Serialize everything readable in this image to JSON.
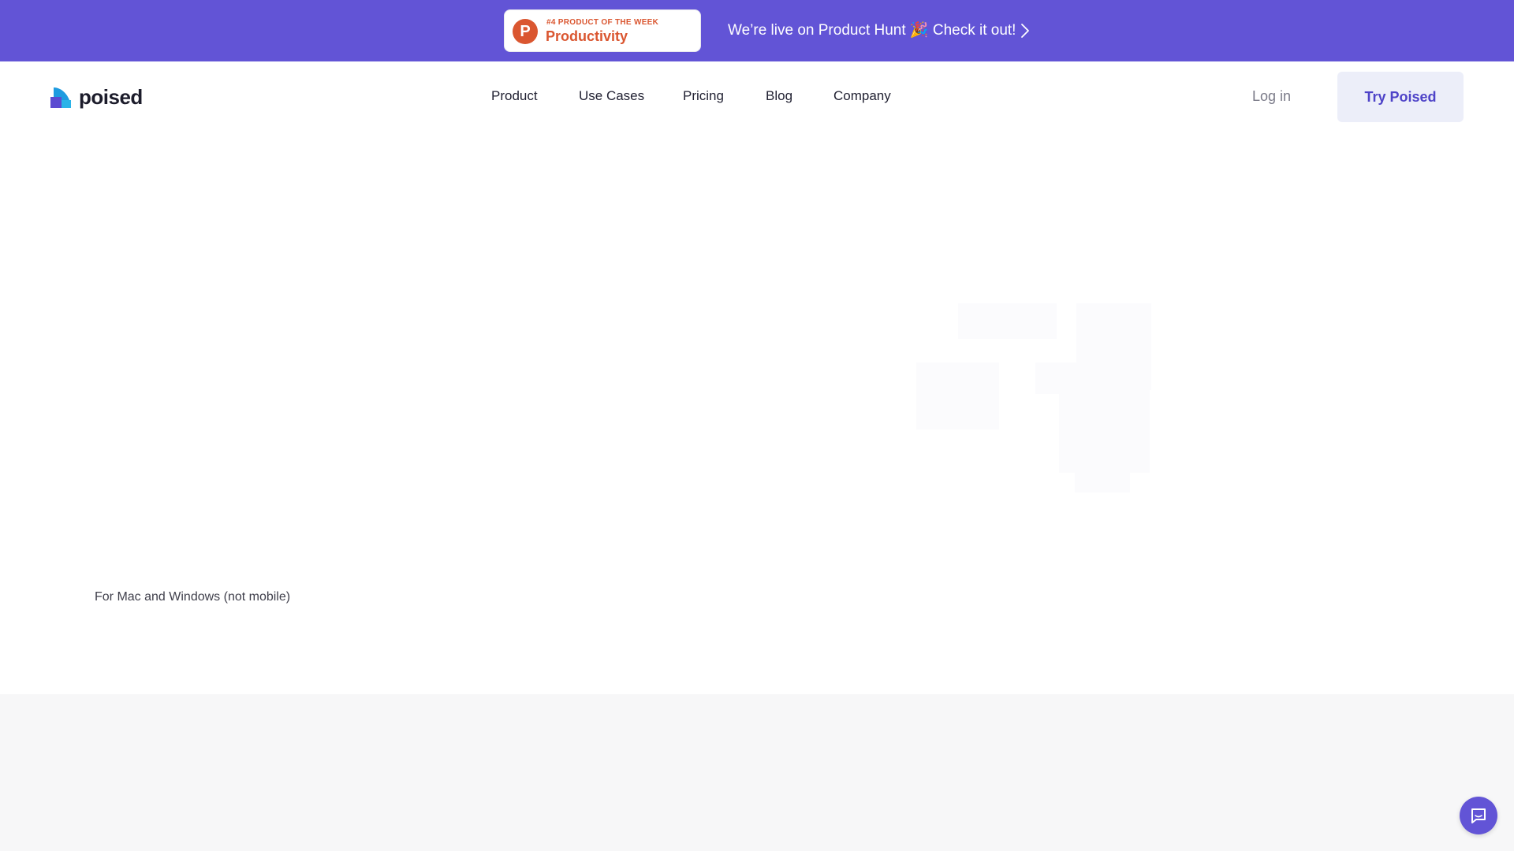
{
  "announcement": {
    "badge_kicker": "#4 PRODUCT OF THE WEEK",
    "badge_title": "Productivity",
    "badge_logo_letter": "P",
    "text": "We’re live on Product Hunt 🎉 Check it out!",
    "arrow_icon": "chevron-right-icon",
    "background_color": "#6254d6",
    "badge_color": "#da5630"
  },
  "header": {
    "logo_text": "poised",
    "nav": [
      {
        "label": "Product"
      },
      {
        "label": "Use Cases"
      },
      {
        "label": "Pricing"
      },
      {
        "label": "Blog"
      },
      {
        "label": "Company"
      }
    ],
    "login_label": "Log in",
    "cta_label": "Try Poised",
    "accent_color": "#4e43c8"
  },
  "hero": {
    "platform_note": "For Mac and Windows (not mobile)"
  },
  "chat_widget": {
    "icon": "chat-bubble-icon"
  }
}
